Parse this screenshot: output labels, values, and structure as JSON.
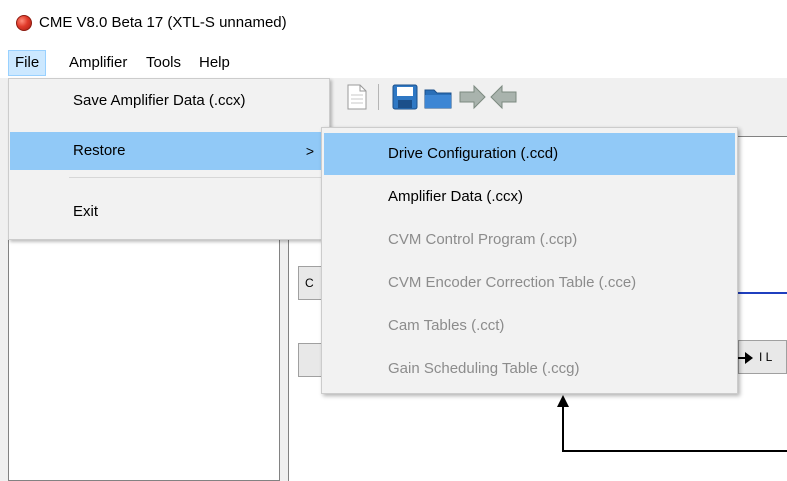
{
  "window": {
    "title": "CME V8.0 Beta 17 (XTL-S unnamed)",
    "icon": "app-icon"
  },
  "menubar": {
    "items": [
      {
        "label": "File",
        "active": true
      },
      {
        "label": "Amplifier",
        "active": false
      },
      {
        "label": "Tools",
        "active": false
      },
      {
        "label": "Help",
        "active": false
      }
    ]
  },
  "file_menu": {
    "items": [
      {
        "label": "Save Amplifier Data (.ccx)",
        "highlighted": false
      },
      {
        "label": "Restore",
        "highlighted": true,
        "submenu_arrow": ">"
      },
      {
        "label": "Exit",
        "highlighted": false
      }
    ]
  },
  "restore_menu": {
    "items": [
      {
        "label": "Drive Configuration (.ccd)",
        "enabled": true,
        "highlighted": true
      },
      {
        "label": "Amplifier Data (.ccx)",
        "enabled": true,
        "highlighted": false
      },
      {
        "label": "CVM Control Program (.ccp)",
        "enabled": false,
        "highlighted": false
      },
      {
        "label": "CVM Encoder Correction Table (.cce)",
        "enabled": false,
        "highlighted": false
      },
      {
        "label": "Cam Tables (.cct)",
        "enabled": false,
        "highlighted": false
      },
      {
        "label": "Gain Scheduling Table (.ccg)",
        "enabled": false,
        "highlighted": false
      }
    ]
  },
  "background": {
    "block_a_label": "C",
    "block_b_label": "I L"
  },
  "colors": {
    "highlight": "#91c9f7",
    "menu_active": "#cce8ff",
    "disabled_text": "#8c8c8c",
    "blue_line": "#1f3fbf"
  }
}
